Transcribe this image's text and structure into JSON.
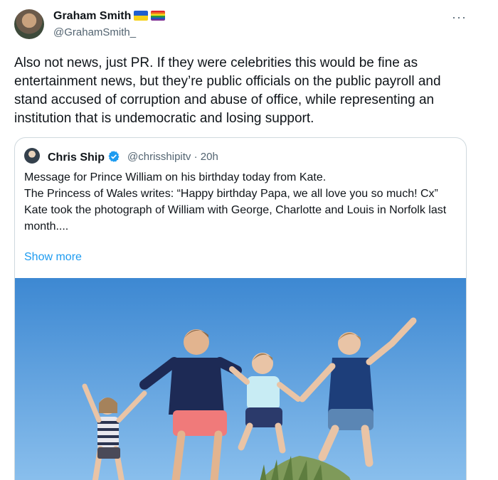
{
  "author": {
    "name": "Graham Smith",
    "handle": "@GrahamSmith_",
    "flags": [
      "ukraine-flag",
      "pride-flag"
    ]
  },
  "more_label": "···",
  "tweet_text": "Also not news, just PR. If they were celebrities this would be fine as entertainment news, but they’re public officials on the public payroll and stand accused of corruption and abuse of office, while representing an institution that is undemocratic and losing support.",
  "quoted": {
    "name": "Chris Ship",
    "handle": "@chrisshipitv",
    "separator": "·",
    "time": "20h",
    "lines": [
      "Message for Prince William on his birthday today from Kate.",
      "The Princess of Wales writes: “Happy birthday Papa, we all love you so much! Cx”",
      "Kate took the photograph of William with George, Charlotte and Louis in Norfolk last month...."
    ],
    "show_more": "Show more"
  },
  "colors": {
    "link": "#1d9bf0",
    "secondary": "#536471",
    "border": "#cfd9de"
  }
}
